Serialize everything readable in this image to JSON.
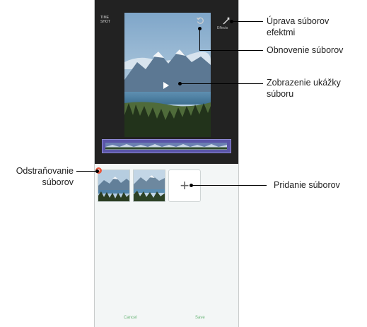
{
  "phone": {
    "top_left_text": "TIME\nSHOT",
    "nav_sub": "",
    "effect_label": "Effects",
    "buttons": {
      "cancel": "Cancel",
      "save": "Save"
    }
  },
  "callouts": {
    "effects": [
      "Úprava súborov",
      "efektmi"
    ],
    "restore": "Obnovenie súborov",
    "preview": [
      "Zobrazenie ukážky",
      "súboru"
    ],
    "remove": [
      "Odstraňovanie",
      "súborov"
    ],
    "add": "Pridanie súborov"
  },
  "icons": {
    "effect": "magic-wand-icon",
    "reset": "reset-icon",
    "play": "play-icon",
    "add": "plus-icon",
    "remove": "close-icon"
  },
  "colors": {
    "dark_bg": "#222222",
    "timeline": "#5a55a8",
    "remove_badge": "#e9583f",
    "action_text": "#6db77b"
  }
}
